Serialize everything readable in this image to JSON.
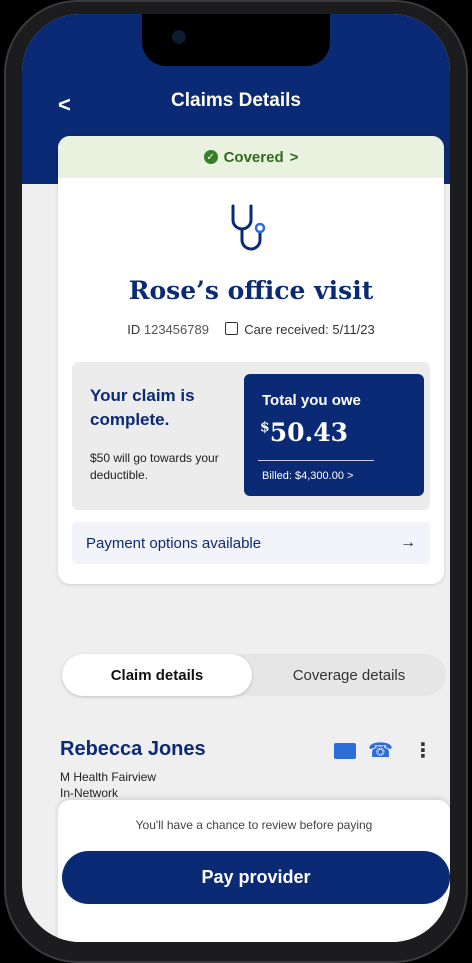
{
  "header": {
    "title": "Claims Details"
  },
  "claim": {
    "status": "Covered",
    "visit_title": "Rose’s office visit",
    "id_label": "ID",
    "id_value": "123456789",
    "care_received": "Care received: 5/11/23",
    "complete_heading": "Your claim is complete.",
    "deductible_note": "$50 will go towards your deductible.",
    "owe_label": "Total you owe",
    "owe_currency": "$",
    "owe_amount": "50.43",
    "billed": "Billed: $4,300.00 >",
    "payment_options": "Payment options available"
  },
  "tabs": [
    {
      "label": "Claim details",
      "active": true
    },
    {
      "label": "Coverage details",
      "active": false
    }
  ],
  "provider": {
    "name": "Rebecca Jones",
    "facility": "M Health Fairview",
    "network": "In-Network"
  },
  "footer": {
    "note": "You'll have a chance to review before paying",
    "button": "Pay provider"
  },
  "colors": {
    "navy": "#0b2a75",
    "green": "#3a7d28",
    "blue_icon": "#2d6cd9"
  },
  "icons": [
    "back-chevron-icon",
    "check-circle-icon",
    "stethoscope-icon",
    "calendar-icon",
    "arrow-right-icon",
    "mail-icon",
    "phone-icon",
    "more-vertical-icon"
  ]
}
